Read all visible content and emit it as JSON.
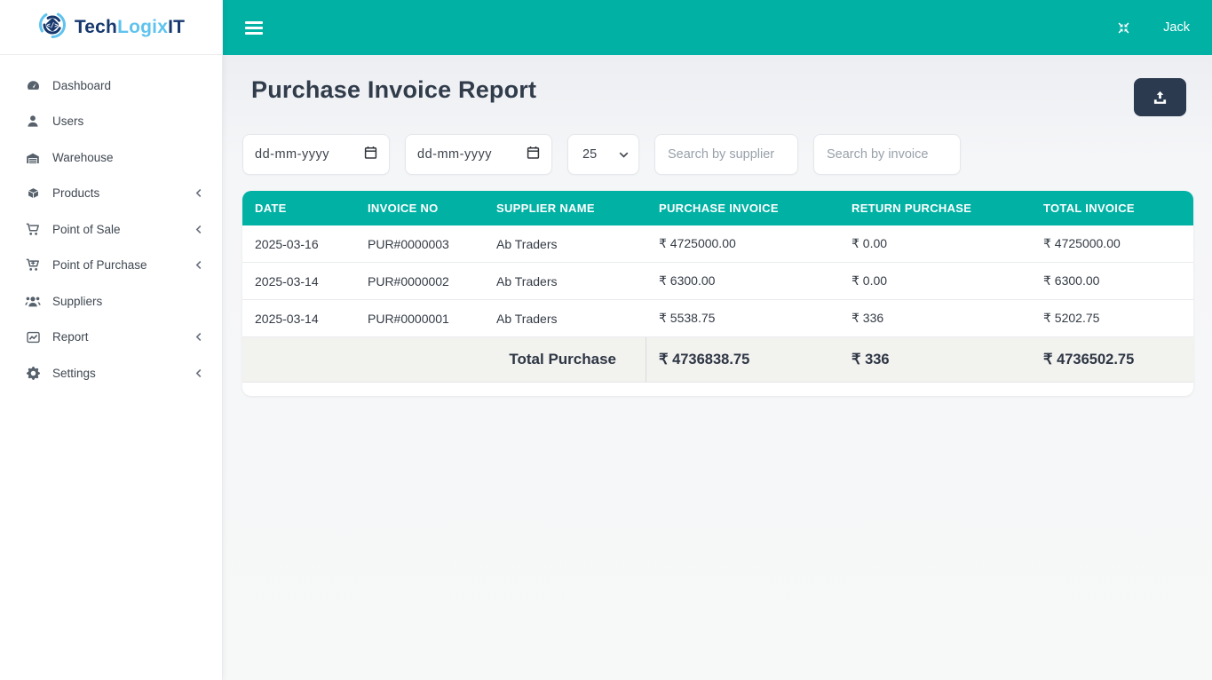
{
  "brand": {
    "tech": "Tech",
    "logix": "Logix",
    "it": "IT"
  },
  "topbar": {
    "username": "Jack"
  },
  "sidebar": {
    "items": [
      {
        "label": "Dashboard"
      },
      {
        "label": "Users"
      },
      {
        "label": "Warehouse"
      },
      {
        "label": "Products"
      },
      {
        "label": "Point of Sale"
      },
      {
        "label": "Point of Purchase"
      },
      {
        "label": "Suppliers"
      },
      {
        "label": "Report"
      },
      {
        "label": "Settings"
      }
    ]
  },
  "page": {
    "title": "Purchase Invoice Report"
  },
  "filters": {
    "date_from": "dd-mm-yyyy",
    "date_to": "dd-mm-yyyy",
    "page_size": "25",
    "search_supplier_placeholder": "Search by supplier",
    "search_invoice_placeholder": "Search by invoice"
  },
  "table": {
    "columns": [
      "DATE",
      "INVOICE NO",
      "SUPPLIER NAME",
      "PURCHASE INVOICE",
      "RETURN PURCHASE",
      "TOTAL INVOICE"
    ],
    "rows": [
      {
        "date": "2025-03-16",
        "invoice_no": "PUR#0000003",
        "supplier": "Ab Traders",
        "purchase_invoice": "₹ 4725000.00",
        "return_purchase": "₹ 0.00",
        "total_invoice": "₹ 4725000.00"
      },
      {
        "date": "2025-03-14",
        "invoice_no": "PUR#0000002",
        "supplier": "Ab Traders",
        "purchase_invoice": "₹ 6300.00",
        "return_purchase": "₹ 0.00",
        "total_invoice": "₹ 6300.00"
      },
      {
        "date": "2025-03-14",
        "invoice_no": "PUR#0000001",
        "supplier": "Ab Traders",
        "purchase_invoice": "₹ 5538.75",
        "return_purchase": "₹ 336",
        "total_invoice": "₹ 5202.75"
      }
    ],
    "footer": {
      "label": "Total Purchase",
      "purchase_invoice": "₹ 4736838.75",
      "return_purchase": "₹ 336",
      "total_invoice": "₹ 4736502.75"
    }
  },
  "colors": {
    "accent": "#00b1a4",
    "brand_dark": "#16386e",
    "brand_light": "#5fc3ee",
    "button_dark": "#2b3a4f"
  }
}
